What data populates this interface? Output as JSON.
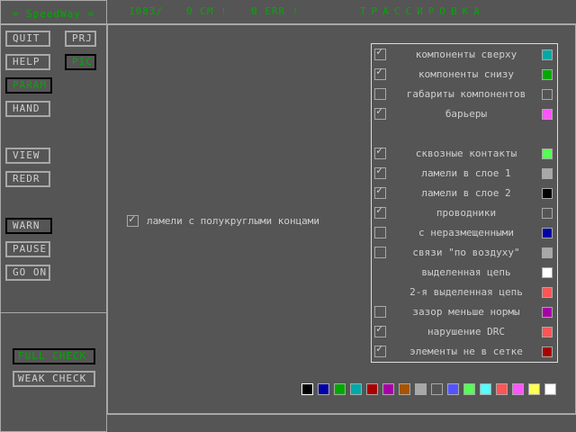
{
  "app_title": "= SpeedWay =",
  "status": {
    "counter": "1083/",
    "cm": "0 CM !",
    "err": "0 ERR !",
    "mode": "ТРАССИРОВКА"
  },
  "buttons": {
    "quit": "QUIT",
    "prj": "PRJ",
    "help": "HELP",
    "pic": "PIC",
    "param": "PARAM",
    "hand": "HAND",
    "view": "VIEW",
    "redr": "REDR",
    "warn": "WARN",
    "pause": "PAUSE",
    "go_on": "GO ON",
    "full_check": "FULL CHECK",
    "weak_check": "WEAK CHECK"
  },
  "standalone_option": {
    "label": "ламели с полукруглыми концами",
    "checked": true
  },
  "layers": [
    {
      "label": "компоненты сверху",
      "checked": true,
      "color": "#00a8a8"
    },
    {
      "label": "компоненты снизу",
      "checked": true,
      "color": "#00a800"
    },
    {
      "label": "габариты компонентов",
      "checked": false,
      "color": "#555555"
    },
    {
      "label": "барьеры",
      "checked": true,
      "color": "#ff54ff"
    },
    {
      "label": "сквозные контакты",
      "checked": true,
      "color": "#54ff54"
    },
    {
      "label": "ламели в слое 1",
      "checked": true,
      "color": "#a8a8a8"
    },
    {
      "label": "ламели в слое 2",
      "checked": true,
      "color": "#000000"
    },
    {
      "label": "проводники",
      "checked": true,
      "color": "#555555"
    },
    {
      "label": "с неразмещенными",
      "checked": false,
      "color": "#0000a8"
    },
    {
      "label": "связи \"по воздуху\"",
      "checked": false,
      "color": "#a8a8a8"
    },
    {
      "label": "выделенная цепь",
      "checked": null,
      "color": "#ffffff"
    },
    {
      "label": "2-я выделенная цепь",
      "checked": null,
      "color": "#ff5454"
    },
    {
      "label": "зазор меньше нормы",
      "checked": false,
      "color": "#a800a8"
    },
    {
      "label": "нарушение DRC",
      "checked": true,
      "color": "#ff5454"
    },
    {
      "label": "элементы не в сетке",
      "checked": true,
      "color": "#a80000"
    }
  ],
  "palette": [
    "#000000",
    "#0000a8",
    "#00a800",
    "#00a8a8",
    "#a80000",
    "#a800a8",
    "#a85400",
    "#a8a8a8",
    "#555555",
    "#5454ff",
    "#54ff54",
    "#54ffff",
    "#ff5454",
    "#ff54ff",
    "#ffff54",
    "#ffffff"
  ],
  "selected_palette_index": 0,
  "check_mark": "✓"
}
